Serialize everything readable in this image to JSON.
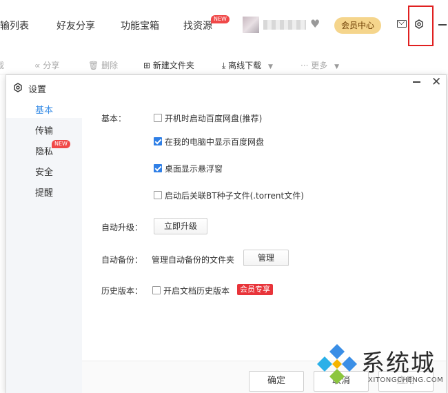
{
  "topnav": {
    "items": [
      {
        "label": "输列表"
      },
      {
        "label": "好友分享"
      },
      {
        "label": "功能宝箱"
      },
      {
        "label": "找资源",
        "badge": "NEW"
      }
    ],
    "vip_label": "会员中心"
  },
  "toolbar": {
    "items": [
      {
        "label": "载"
      },
      {
        "label": "分享"
      },
      {
        "label": "删除"
      },
      {
        "label": "新建文件夹"
      },
      {
        "label": "离线下载"
      },
      {
        "label": "更多"
      }
    ]
  },
  "dialog": {
    "title": "设置",
    "sidebar": [
      {
        "label": "基本",
        "active": true
      },
      {
        "label": "传输"
      },
      {
        "label": "隐私",
        "badge": "NEW"
      },
      {
        "label": "安全"
      },
      {
        "label": "提醒"
      }
    ],
    "basic": {
      "label": "基本：",
      "options": [
        {
          "label": "开机时启动百度网盘(推荐)",
          "checked": false
        },
        {
          "label": "在我的电脑中显示百度网盘",
          "checked": true
        },
        {
          "label": "桌面显示悬浮窗",
          "checked": true
        },
        {
          "label": "启动后关联BT种子文件(.torrent文件)",
          "checked": false
        }
      ]
    },
    "auto_upgrade": {
      "label": "自动升级：",
      "button": "立即升级"
    },
    "auto_backup": {
      "label": "自动备份：",
      "text": "管理自动备份的文件夹",
      "button": "管理"
    },
    "history": {
      "label": "历史版本：",
      "option": "开启文档历史版本",
      "checked": false,
      "tag": "会员专享"
    },
    "footer": {
      "ok": "确定",
      "cancel": "取消",
      "apply": "应用"
    }
  },
  "watermark": {
    "title": "系统城",
    "sub": "XITONGCHENG.COM"
  },
  "colors": {
    "accent": "#3a8ee6",
    "highlight": "#e02020",
    "vip": "#f5d58c",
    "member_tag": "#e8343a"
  }
}
